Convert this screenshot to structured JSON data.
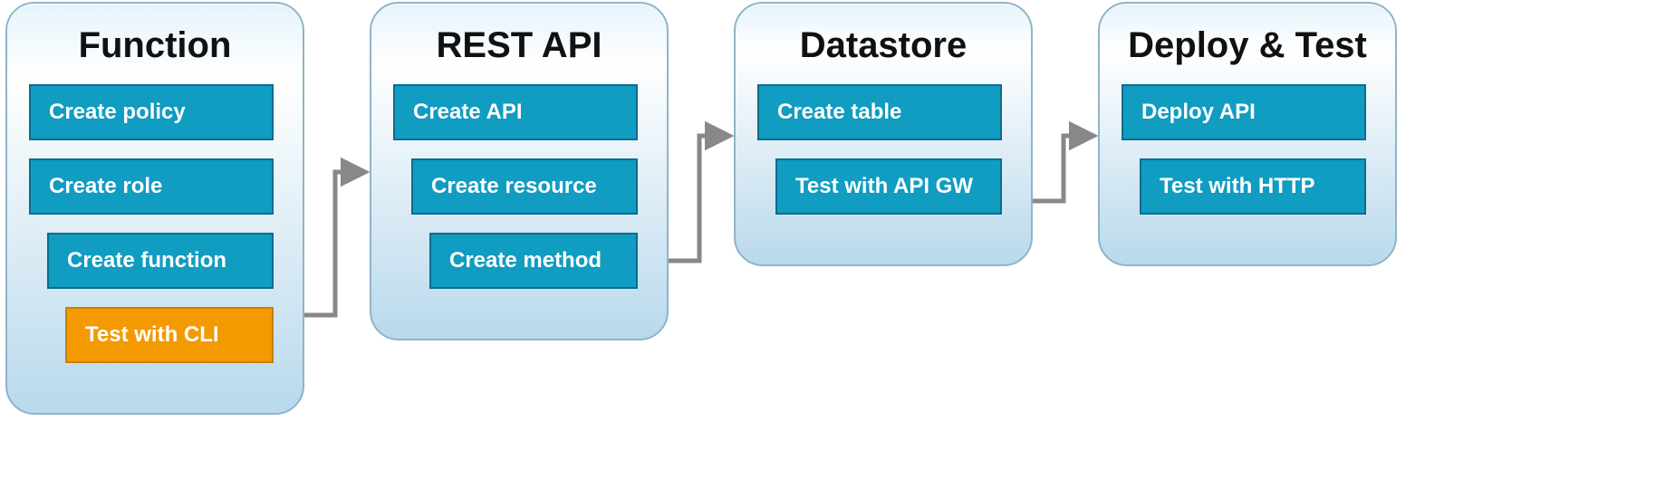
{
  "colors": {
    "teal": "#119cc1",
    "orange": "#f29a00",
    "panel_border": "#8fb4c9",
    "arrow": "#888888"
  },
  "panels": [
    {
      "id": "function",
      "title": "Function",
      "steps": [
        {
          "label": "Create policy",
          "variant": "teal",
          "indent": 0
        },
        {
          "label": "Create role",
          "variant": "teal",
          "indent": 0
        },
        {
          "label": "Create function",
          "variant": "teal",
          "indent": 1
        },
        {
          "label": "Test with CLI",
          "variant": "orange",
          "indent": 2
        }
      ]
    },
    {
      "id": "rest-api",
      "title": "REST API",
      "steps": [
        {
          "label": "Create API",
          "variant": "teal",
          "indent": 0
        },
        {
          "label": "Create resource",
          "variant": "teal",
          "indent": 1
        },
        {
          "label": "Create method",
          "variant": "teal",
          "indent": 2
        }
      ]
    },
    {
      "id": "datastore",
      "title": "Datastore",
      "steps": [
        {
          "label": "Create table",
          "variant": "teal",
          "indent": 0
        },
        {
          "label": "Test with API GW",
          "variant": "teal",
          "indent": 1
        }
      ]
    },
    {
      "id": "deploy-test",
      "title": "Deploy & Test",
      "steps": [
        {
          "label": "Deploy API",
          "variant": "teal",
          "indent": 0
        },
        {
          "label": "Test with HTTP",
          "variant": "teal",
          "indent": 1
        }
      ]
    }
  ]
}
